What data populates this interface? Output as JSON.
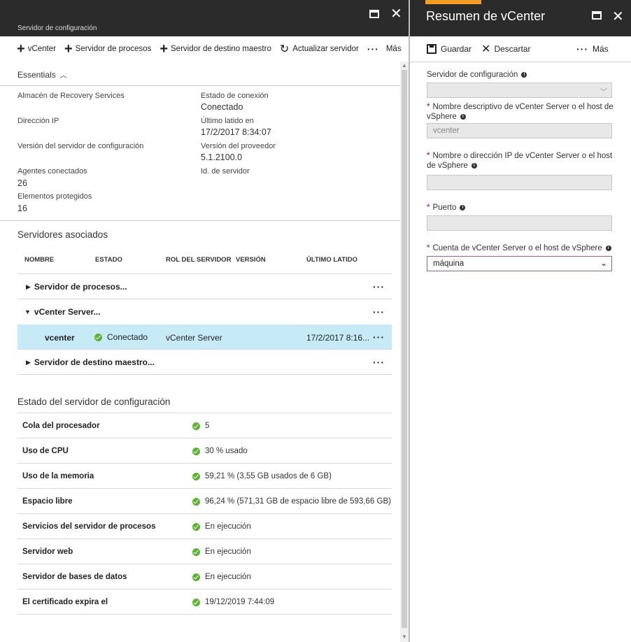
{
  "left": {
    "subtitle": "Servidor de configuración",
    "toolbar": {
      "vcenter": "vCenter",
      "process_server": "Servidor de procesos",
      "master_target": "Servidor de destino maestro",
      "refresh": "Actualizar servidor",
      "more": "Más"
    },
    "essentials": {
      "title": "Essentials",
      "vault_label": "Almacén de Recovery Services",
      "ip_label": "Dirección IP",
      "cs_version_label": "Versión del servidor de configuración",
      "agents_label": "Agentes conectados",
      "agents_value": "26",
      "protected_label": "Elementos protegidos",
      "protected_value": "16",
      "conn_state_label": "Estado de conexión",
      "conn_state_value": "Conectado",
      "heartbeat_label": "Último latido en",
      "heartbeat_value": "17/2/2017 8:34:07",
      "provider_label": "Versión del proveedor",
      "provider_value": "5.1.2100.0",
      "server_id_label": "Id. de servidor"
    },
    "associated": {
      "title": "Servidores asociados",
      "columns": [
        "NOMBRE",
        "ESTADO",
        "ROL DEL SERVIDOR",
        "VERSIÓN",
        "ÚLTIMO LATIDO"
      ],
      "group1": "Servidor de procesos...",
      "group2": "vCenter Server...",
      "row_name": "vcenter",
      "row_status": "Conectado",
      "row_role": "vCenter Server",
      "row_heartbeat": "17/2/2017 8:16...",
      "group3": "Servidor de destino maestro..."
    },
    "health": {
      "title": "Estado del servidor de configuración",
      "rows": [
        {
          "name": "Cola del procesador",
          "value": "5"
        },
        {
          "name": "Uso de CPU",
          "value": "30 % usado"
        },
        {
          "name": "Uso de la memoria",
          "value": "59,21 % (3,55 GB usados de 6 GB)"
        },
        {
          "name": "Espacio libre",
          "value": "96,24 % (571,31 GB de espacio libre de 593,66 GB)"
        },
        {
          "name": "Servicios del servidor de procesos",
          "value": "En ejecución"
        },
        {
          "name": "Servidor web",
          "value": "En ejecución"
        },
        {
          "name": "Servidor de bases de datos",
          "value": "En ejecución"
        },
        {
          "name": "El certificado expira el",
          "value": "19/12/2019 7:44:09"
        }
      ]
    }
  },
  "right": {
    "title": "Resumen de vCenter",
    "toolbar": {
      "save": "Guardar",
      "discard": "Descartar",
      "more": "Más"
    },
    "form": {
      "cs_label": "Servidor de configuración",
      "friendly_label": "Nombre descriptivo de vCenter Server o el host de vSphere",
      "friendly_value": "vcenter",
      "ip_label": "Nombre o dirección IP de vCenter Server o el host de vSphere",
      "port_label": "Puerto",
      "account_label": "Cuenta de vCenter Server o el host de vSphere",
      "account_value": "máquina",
      "info_glyph": "i"
    }
  },
  "colors": {
    "header_bg": "#2b2b2b",
    "accent_orange": "#f59d22",
    "selected_row": "#c7eaf7",
    "status_green": "#59b52b",
    "required_red": "#cc0000"
  }
}
